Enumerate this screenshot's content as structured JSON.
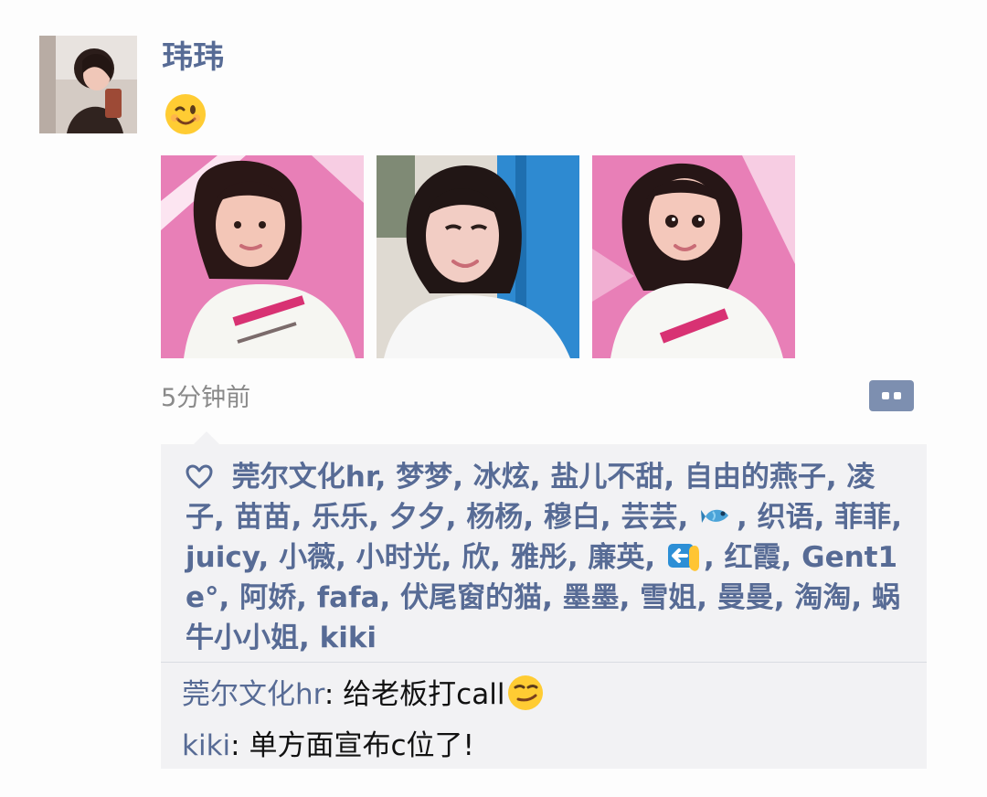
{
  "post": {
    "author": "玮玮",
    "emoji_icon": "winking-face-icon",
    "photos": [
      {
        "icon": "selfie-photo-icon",
        "alt": "selfie-pink-backdrop"
      },
      {
        "icon": "selfie-photo-icon",
        "alt": "selfie-blue-backdrop"
      },
      {
        "icon": "selfie-photo-icon",
        "alt": "selfie-close-up"
      }
    ],
    "timestamp": "5分钟前",
    "comment_button_icon": "more-options-icon"
  },
  "likes": {
    "icon": "heart-outline-icon",
    "comma": ",",
    "names": [
      "莞尔文化hr",
      "梦梦",
      "冰炫",
      "盐儿不甜",
      "自由的燕子",
      "凌子",
      "苗苗",
      "乐乐",
      "夕夕",
      "杨杨",
      "穆白",
      "芸芸",
      "",
      "织语",
      "菲菲",
      "juicy",
      "小薇",
      "小时光",
      "欣",
      "雅彤",
      "廉英",
      "",
      "红霞",
      "Gent1e°",
      "阿娇",
      "fafa",
      "伏尾窗的猫",
      "墨墨",
      "雪姐",
      "曼曼",
      "淘淘",
      "蜗牛小小姐",
      "kiki"
    ],
    "emoji_names": {
      "12": "fish-icon",
      "21": "left-arrow-pointing-down-hand-icon"
    }
  },
  "comments": [
    {
      "author": "莞尔文化hr",
      "separator": ": ",
      "text": "给老板打call",
      "emoji_icon": "smirking-face-icon"
    },
    {
      "author": "kiki",
      "separator": ": ",
      "text": "单方面宣布c位了!",
      "emoji_icon": ""
    }
  ],
  "colors": {
    "link": "#576b95",
    "timestamp": "#8a8a8a",
    "panel": "#f2f2f4",
    "comment_button": "#7d8fb0"
  }
}
